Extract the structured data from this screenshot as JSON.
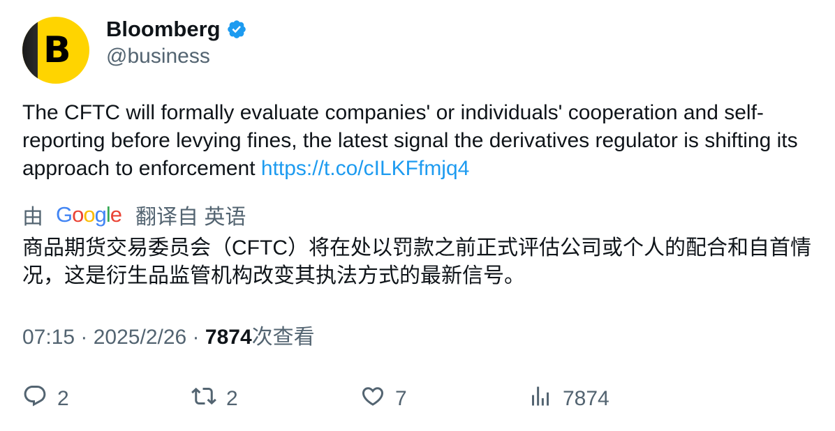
{
  "author": {
    "name": "Bloomberg",
    "handle": "@business",
    "avatar_letter": "B",
    "verified": true
  },
  "tweet": {
    "text": "The CFTC will formally evaluate companies' or individuals' cooperation and self-reporting before levying fines, the latest signal the derivatives regulator is shifting its approach to enforcement ",
    "link": "https://t.co/cILKFfmjq4"
  },
  "translation": {
    "prefix": "由",
    "provider": "Google",
    "suffix": "翻译自 英语",
    "text": "商品期货交易委员会（CFTC）将在处以罚款之前正式评估公司或个人的配合和自首情况，这是衍生品监管机构改变其执法方式的最新信号。"
  },
  "meta": {
    "time": "07:15",
    "separator": " · ",
    "date": "2025/2/26",
    "views": "7874",
    "views_label": "次查看"
  },
  "actions": {
    "replies": "2",
    "retweets": "2",
    "likes": "7",
    "views": "7874"
  },
  "colors": {
    "text": "#0f1419",
    "secondary": "#536471",
    "link": "#1d9bf0",
    "verified": "#1d9bf0",
    "avatar_bg": "#ffd400"
  }
}
